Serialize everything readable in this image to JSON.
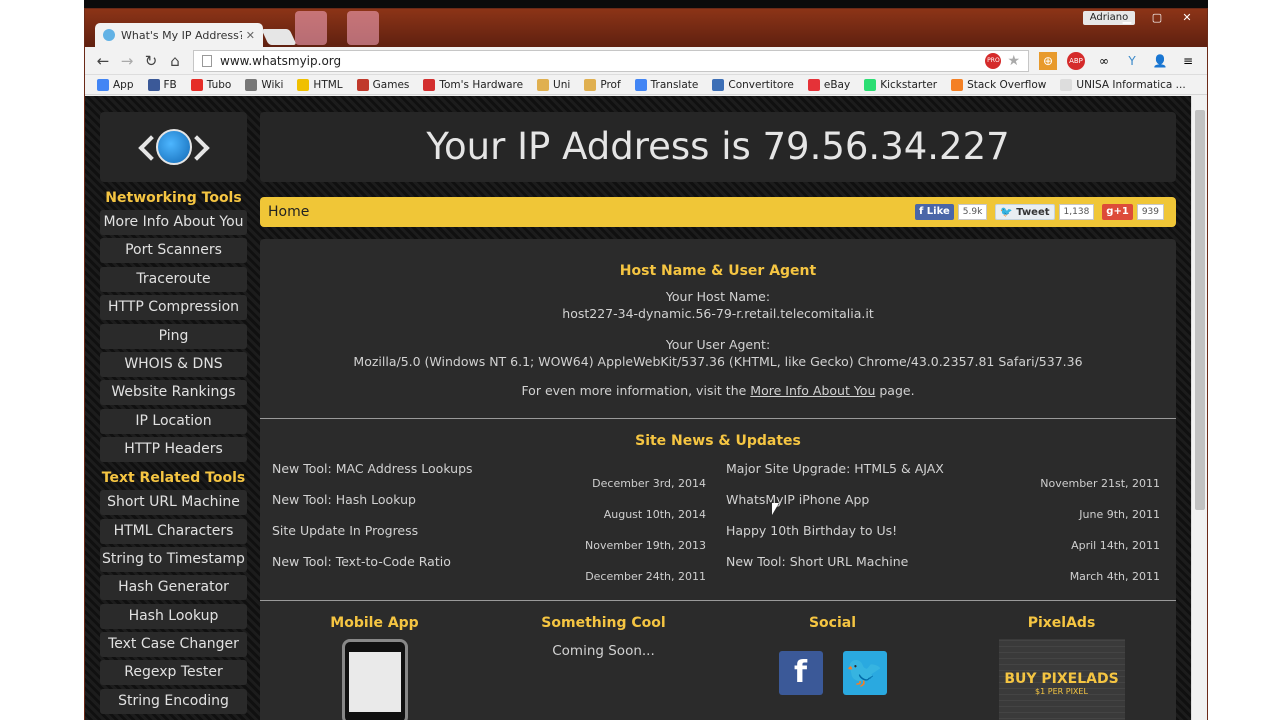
{
  "browser": {
    "tab_title": "What's My IP Address? N",
    "url": "www.whatsmyip.org",
    "user_name": "Adriano",
    "bookmarks": [
      {
        "label": "App",
        "color": "#4285f4"
      },
      {
        "label": "FB",
        "color": "#3b5998"
      },
      {
        "label": "Tubo",
        "color": "#e52d27"
      },
      {
        "label": "Wiki",
        "color": "#777777"
      },
      {
        "label": "HTML",
        "color": "#f0c000"
      },
      {
        "label": "Games",
        "color": "#c0392b"
      },
      {
        "label": "Tom's Hardware",
        "color": "#d32f2f"
      },
      {
        "label": "Uni",
        "color": "#e0b050"
      },
      {
        "label": "Prof",
        "color": "#e0b050"
      },
      {
        "label": "Translate",
        "color": "#4285f4"
      },
      {
        "label": "Convertitore",
        "color": "#3d6fb6"
      },
      {
        "label": "eBay",
        "color": "#e53238"
      },
      {
        "label": "Kickstarter",
        "color": "#2bde73"
      },
      {
        "label": "Stack Overflow",
        "color": "#f48024"
      },
      {
        "label": "UNISA Informatica ...",
        "color": "#dddddd"
      }
    ]
  },
  "sidebar": {
    "networking_heading": "Networking Tools",
    "networking_items": [
      "More Info About You",
      "Port Scanners",
      "Traceroute",
      "HTTP Compression",
      "Ping",
      "WHOIS & DNS",
      "Website Rankings",
      "IP Location",
      "HTTP Headers"
    ],
    "text_heading": "Text Related Tools",
    "text_items": [
      "Short URL Machine",
      "HTML Characters",
      "String to Timestamp",
      "Hash Generator",
      "Hash Lookup",
      "Text Case Changer",
      "Regexp Tester",
      "String Encoding"
    ]
  },
  "main": {
    "ip_banner": "Your IP Address is 79.56.34.227",
    "home_label": "Home",
    "social": {
      "like": "Like",
      "like_count": "5.9k",
      "tweet": "Tweet",
      "tweet_count": "1,138",
      "gplus": "+1",
      "gplus_count": "939"
    },
    "host": {
      "title": "Host Name & User Agent",
      "host_label": "Your Host Name:",
      "host_value": "host227-34-dynamic.56-79-r.retail.telecomitalia.it",
      "ua_label": "Your User Agent:",
      "ua_value": "Mozilla/5.0 (Windows NT 6.1; WOW64) AppleWebKit/537.36 (KHTML, like Gecko) Chrome/43.0.2357.81 Safari/537.36",
      "more_prefix": "For even more information, visit the",
      "more_link": "More Info About You",
      "more_suffix": "page."
    },
    "news": {
      "title": "Site News & Updates",
      "left": [
        {
          "title": "New Tool: MAC Address Lookups",
          "date": "December 3rd, 2014"
        },
        {
          "title": "New Tool: Hash Lookup",
          "date": "August 10th, 2014"
        },
        {
          "title": "Site Update In Progress",
          "date": "November 19th, 2013"
        },
        {
          "title": "New Tool: Text-to-Code Ratio",
          "date": "December 24th, 2011"
        }
      ],
      "right": [
        {
          "title": "Major Site Upgrade: HTML5 & AJAX",
          "date": "November 21st, 2011"
        },
        {
          "title": "WhatsMyIP iPhone App",
          "date": "June 9th, 2011"
        },
        {
          "title": "Happy 10th Birthday to Us!",
          "date": "April 14th, 2011"
        },
        {
          "title": "New Tool: Short URL Machine",
          "date": "March 4th, 2011"
        }
      ]
    },
    "footer": {
      "mobile_title": "Mobile App",
      "cool_title": "Something Cool",
      "cool_text": "Coming Soon...",
      "social_title": "Social",
      "pixelads_title": "PixelAds",
      "pixelads_big": "BUY PIXELADS",
      "pixelads_small": "$1 PER PIXEL"
    }
  }
}
